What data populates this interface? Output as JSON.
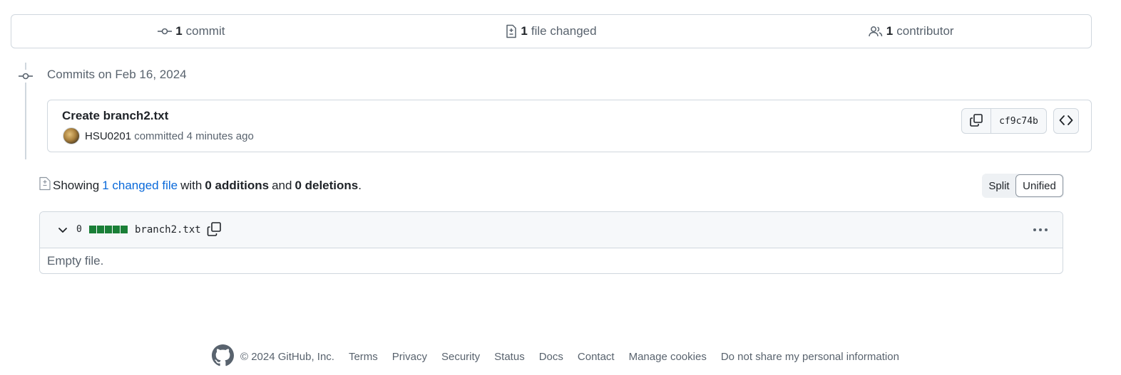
{
  "summary": {
    "commits": {
      "count": "1",
      "label": "commit",
      "icon": "git-commit-icon"
    },
    "files": {
      "count": "1",
      "label": "file changed",
      "icon": "file-diff-icon"
    },
    "contributors": {
      "count": "1",
      "label": "contributor",
      "icon": "people-icon"
    }
  },
  "timeline": {
    "heading": "Commits on Feb 16, 2024"
  },
  "commit": {
    "title": "Create branch2.txt",
    "author": "HSU0201",
    "action": "committed",
    "time": "4 minutes ago",
    "sha": "cf9c74b"
  },
  "diff_summary": {
    "showing": "Showing",
    "changed_files": "1 changed file",
    "with": "with",
    "additions": "0 additions",
    "and": "and",
    "deletions": "0 deletions",
    "period": "."
  },
  "view_toggle": {
    "split": "Split",
    "unified": "Unified",
    "selected": "Unified"
  },
  "file": {
    "change_count": "0",
    "name": "branch2.txt",
    "empty_note": "Empty file.",
    "diffstat_color": "#1a7f37"
  },
  "footer": {
    "copyright": "© 2024 GitHub, Inc.",
    "links": [
      "Terms",
      "Privacy",
      "Security",
      "Status",
      "Docs",
      "Contact",
      "Manage cookies",
      "Do not share my personal information"
    ]
  },
  "colors": {
    "border": "#d0d7de",
    "muted": "#59636e",
    "link": "#0969da",
    "text": "#1f2328"
  }
}
